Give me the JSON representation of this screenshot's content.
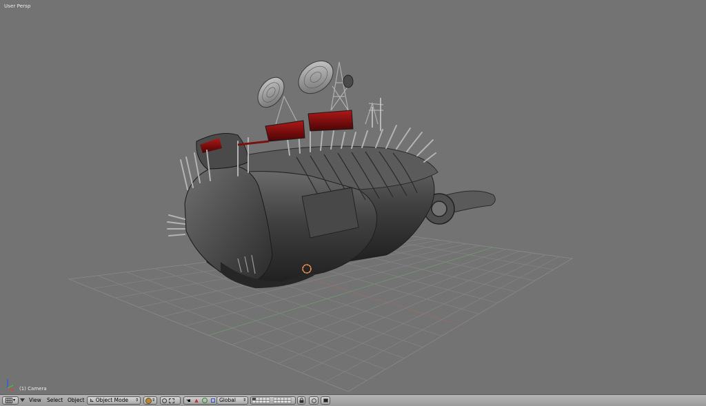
{
  "viewport": {
    "view_label": "User Persp",
    "object_label": "(1) Camera"
  },
  "header": {
    "editor_type_icon": "grid-editor-icon",
    "menus": [
      "View",
      "Select",
      "Object"
    ],
    "mode_select": {
      "label": "Object Mode",
      "icon": "object-mode-icon"
    },
    "orientation_select": {
      "label": "Global"
    },
    "icons": [
      "viewport-shading-icon",
      "pivot-icon",
      "manipulator-hand-icon",
      "translate-icon",
      "rotate-icon",
      "scale-icon",
      "layers-grid-icon",
      "lock-icon",
      "render-icon",
      "camera-icon"
    ]
  },
  "colors": {
    "viewport_bg": "#737373",
    "grid_line": "#848484",
    "x_axis": "#9a6a6a",
    "y_axis": "#6f9a6f",
    "header_bg": "#a8a8a8",
    "model_body": "#3e3e3e",
    "model_accent_red": "#7a1010"
  }
}
